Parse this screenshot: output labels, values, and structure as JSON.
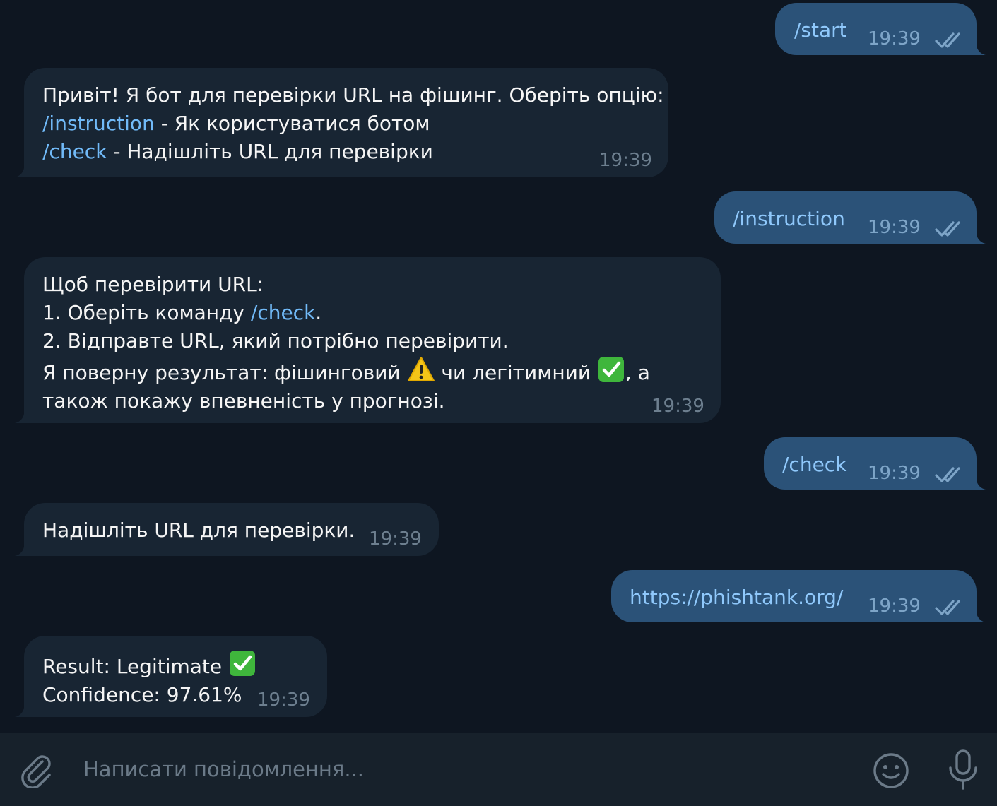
{
  "messages": [
    {
      "id": "m1",
      "direction": "outgoing",
      "text": "/start",
      "time": "19:39",
      "status": "read"
    },
    {
      "id": "m2",
      "direction": "incoming",
      "time": "19:39",
      "lines": {
        "l1": "Привіт! Я бот для перевірки URL на фішинг. Оберіть опцію:",
        "l2_cmd": "/instruction",
        "l2_rest": " - Як користуватися ботом",
        "l3_cmd": "/check",
        "l3_rest": " - Надішліть URL для перевірки"
      }
    },
    {
      "id": "m3",
      "direction": "outgoing",
      "text": "/instruction",
      "time": "19:39",
      "status": "read"
    },
    {
      "id": "m4",
      "direction": "incoming",
      "time": "19:39",
      "lines": {
        "l1": "Щоб перевірити URL:",
        "l2_pre": "1. Оберіть команду ",
        "l2_cmd": "/check",
        "l2_post": ".",
        "l3": "2. Відправте URL, який потрібно перевірити.",
        "l4_pre": "Я поверну результат: фішинговий ",
        "l4_mid": " чи легітимний ",
        "l4_post": ", а",
        "l5": "також покажу впевненість у прогнозі."
      }
    },
    {
      "id": "m5",
      "direction": "outgoing",
      "text": "/check",
      "time": "19:39",
      "status": "read"
    },
    {
      "id": "m6",
      "direction": "incoming",
      "text": "Надішліть URL для перевірки.",
      "time": "19:39"
    },
    {
      "id": "m7",
      "direction": "outgoing",
      "text": "https://phishtank.org/",
      "time": "19:39",
      "status": "read"
    },
    {
      "id": "m8",
      "direction": "incoming",
      "time": "19:39",
      "lines": {
        "l1": "Result: Legitimate ",
        "l2": "Confidence: 97.61%"
      }
    }
  ],
  "composer": {
    "placeholder": "Написати повідомлення...",
    "icons": [
      "paperclip-icon",
      "smile-icon",
      "microphone-icon"
    ]
  },
  "colors": {
    "background": "#0e1621",
    "incoming_bubble": "#182533",
    "outgoing_bubble": "#2b5278",
    "link": "#71baf8",
    "composer": "#17212b"
  }
}
